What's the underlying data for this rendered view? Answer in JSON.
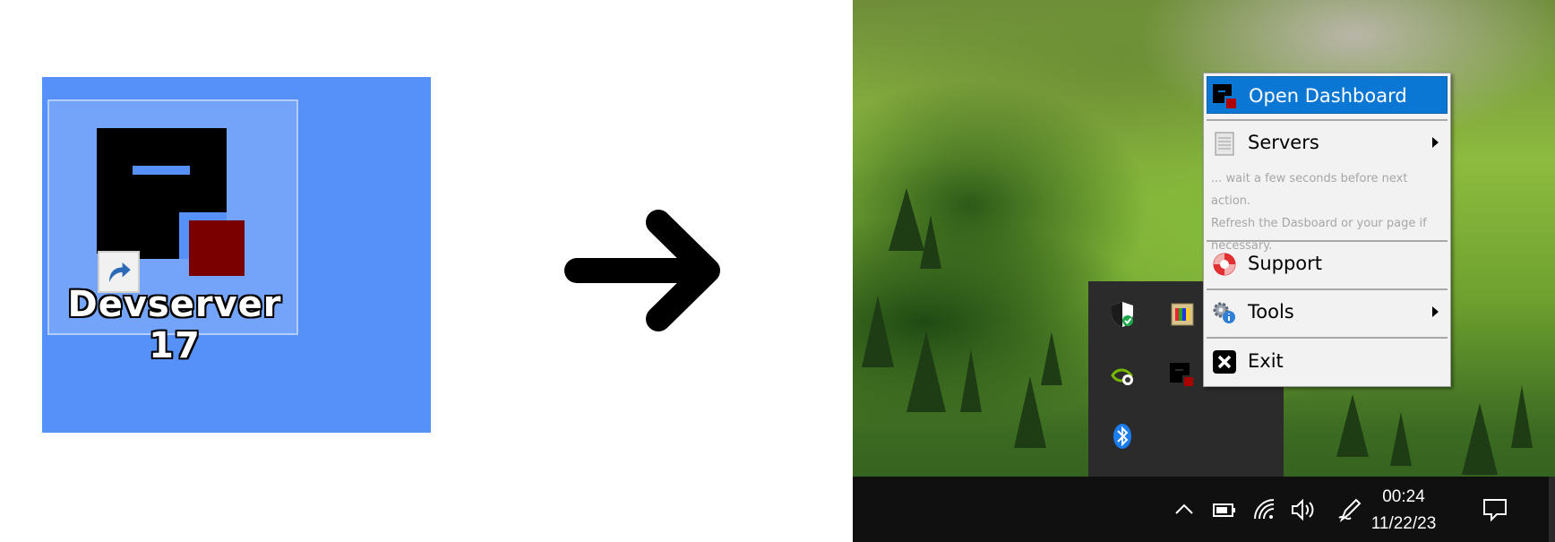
{
  "desktop_icon": {
    "label": "Devserver 17",
    "icon": "devserver-logo-icon",
    "overlay": "shortcut-arrow-icon",
    "background_color": "#5591f9"
  },
  "transition_arrow": {
    "icon": "right-arrow-icon"
  },
  "context_menu": {
    "items": [
      {
        "label": "Open Dashboard",
        "icon": "devserver-logo-icon",
        "highlighted": true
      },
      {
        "label": "Servers",
        "icon": "server-icon",
        "submenu": true
      },
      {
        "label": "Support",
        "icon": "lifebuoy-icon"
      },
      {
        "label": "Tools",
        "icon": "gears-icon",
        "submenu": true
      },
      {
        "label": "Exit",
        "icon": "close-icon"
      }
    ],
    "note_lines": [
      "... wait a few seconds before next action.",
      "Refresh the Dasboard or your page if",
      "necessary."
    ],
    "highlight_color": "#0b77d4"
  },
  "tray_overflow": {
    "icons": [
      "security-shield-icon",
      "color-palette-icon",
      "nvidia-icon",
      "devserver-logo-icon",
      "bluetooth-icon"
    ]
  },
  "taskbar": {
    "icons": [
      "chevron-up-icon",
      "battery-icon",
      "wifi-icon",
      "volume-icon",
      "pen-icon"
    ],
    "clock": {
      "time": "00:24",
      "date": "11/22/23"
    },
    "notification_icon": "notification-icon"
  }
}
